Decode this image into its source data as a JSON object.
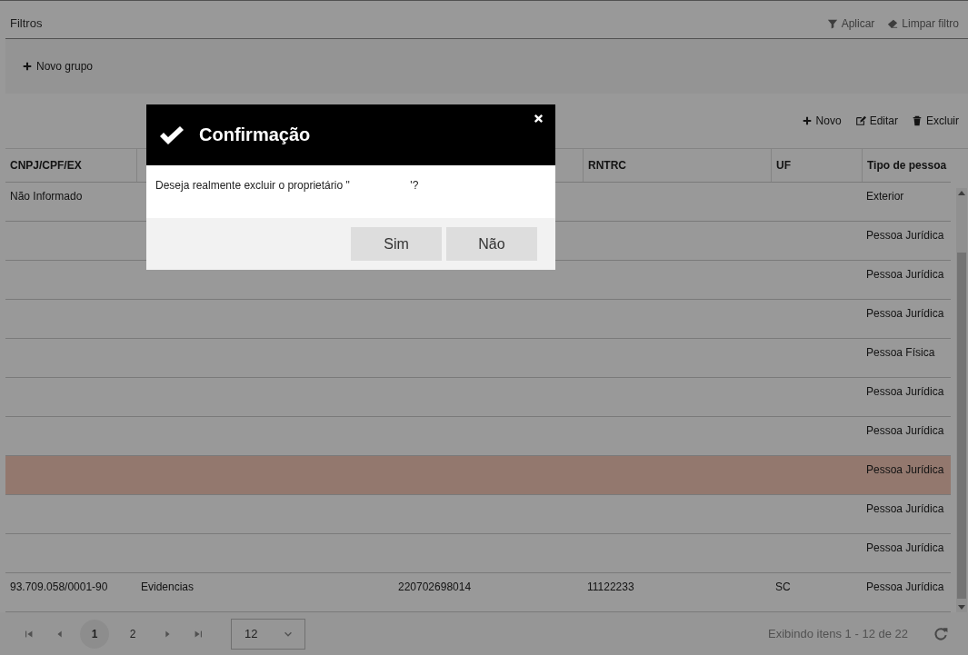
{
  "filters": {
    "title": "Filtros",
    "actions": [
      {
        "kind": "filter",
        "label": "Aplicar"
      },
      {
        "kind": "eraser",
        "label": "Limpar filtro"
      }
    ],
    "add_group": "Novo grupo"
  },
  "toolbar": [
    {
      "kind": "plus",
      "label": "Novo"
    },
    {
      "kind": "edit",
      "label": "Editar"
    },
    {
      "kind": "trash",
      "label": "Excluir"
    }
  ],
  "table": {
    "columns": [
      {
        "label": "CNPJ/CPF/EX"
      },
      {},
      {},
      {},
      {
        "label": "RNTRC"
      },
      {
        "label": "UF"
      },
      {
        "label": "Tipo de pessoa"
      }
    ],
    "rows": [
      {
        "selected": false,
        "cells": [
          "Não Informado",
          null,
          null,
          null,
          null,
          null,
          "Exterior"
        ]
      },
      {
        "selected": false,
        "cells": [
          null,
          null,
          null,
          null,
          null,
          null,
          "Pessoa Jurídica"
        ]
      },
      {
        "selected": false,
        "cells": [
          null,
          null,
          null,
          null,
          null,
          null,
          "Pessoa Jurídica"
        ]
      },
      {
        "selected": false,
        "cells": [
          null,
          null,
          null,
          null,
          null,
          null,
          "Pessoa Jurídica"
        ]
      },
      {
        "selected": false,
        "cells": [
          null,
          null,
          null,
          null,
          null,
          null,
          "Pessoa Física"
        ]
      },
      {
        "selected": false,
        "cells": [
          null,
          null,
          null,
          null,
          null,
          null,
          "Pessoa Jurídica"
        ]
      },
      {
        "selected": false,
        "cells": [
          null,
          null,
          null,
          null,
          null,
          null,
          "Pessoa Jurídica"
        ]
      },
      {
        "selected": true,
        "cells": [
          null,
          null,
          null,
          null,
          null,
          null,
          "Pessoa Jurídica"
        ]
      },
      {
        "selected": false,
        "cells": [
          null,
          null,
          null,
          null,
          null,
          null,
          "Pessoa Jurídica"
        ]
      },
      {
        "selected": false,
        "cells": [
          null,
          null,
          null,
          null,
          null,
          null,
          "Pessoa Jurídica"
        ]
      },
      {
        "selected": false,
        "cells": [
          "93.709.058/0001-90",
          "Evidencias",
          null,
          "220702698014",
          "11122233",
          "SC",
          "Pessoa Jurídica"
        ]
      }
    ]
  },
  "pager": {
    "pages": [
      {
        "label": "1",
        "selected": true
      },
      {
        "label": "2",
        "selected": false
      }
    ],
    "page_size": "12",
    "summary": "Exibindo itens 1 - 12 de 22"
  },
  "dialog": {
    "title": "Confirmação",
    "message": "Deseja realmente excluir o proprietário \"                    '?",
    "buttons": [
      "Sim",
      "Não"
    ]
  }
}
